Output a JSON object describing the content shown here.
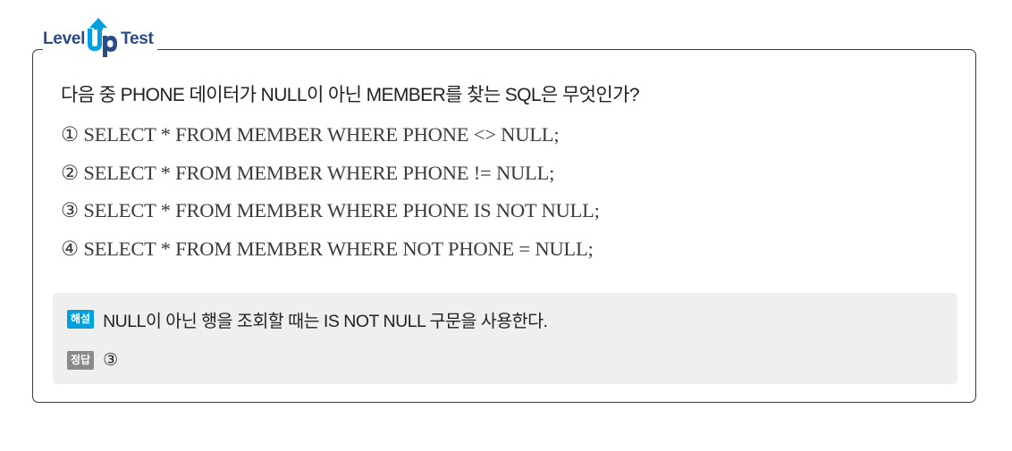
{
  "header": {
    "logo_left": "Level",
    "logo_middle": "Up",
    "logo_right": "Test"
  },
  "question": "다음 중 PHONE 데이터가 NULL이 아닌 MEMBER를 찾는 SQL은 무엇인가?",
  "options": [
    "① SELECT * FROM MEMBER WHERE PHONE <> NULL;",
    "② SELECT * FROM MEMBER WHERE PHONE != NULL;",
    "③ SELECT * FROM MEMBER WHERE PHONE IS NOT NULL;",
    "④ SELECT * FROM MEMBER WHERE NOT PHONE = NULL;"
  ],
  "explanation": {
    "label": "해설",
    "text": "NULL이 아닌 행을 조회할 때는 IS NOT NULL 구문을 사용한다."
  },
  "answer": {
    "label": "정답",
    "value": "③"
  },
  "colors": {
    "logo_blue": "#2a4a8a",
    "logo_cyan": "#00a0e0",
    "explanation_badge": "#00a0e0",
    "answer_badge": "#8a8a8a",
    "answer_box_bg": "#efefef",
    "card_border": "#3a3a3a"
  }
}
